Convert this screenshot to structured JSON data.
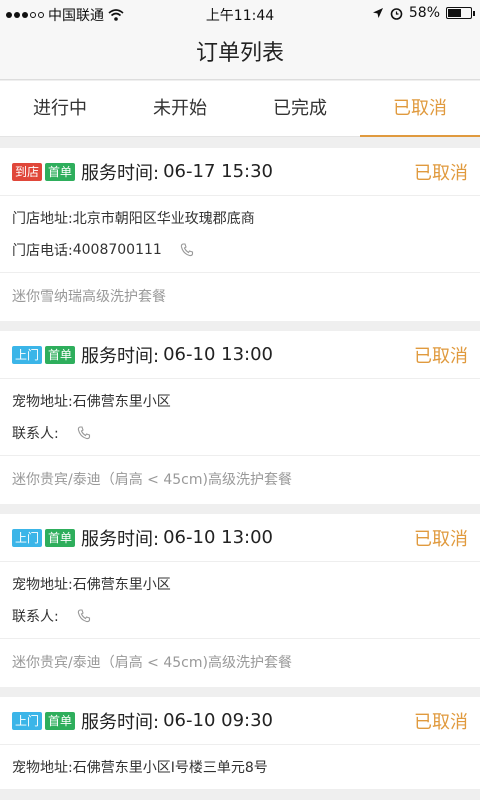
{
  "status_bar": {
    "carrier": "中国联通",
    "time": "上午11:44",
    "battery": "58%",
    "battery_level": 0.58
  },
  "nav": {
    "title": "订单列表"
  },
  "tabs": [
    {
      "label": "进行中",
      "active": false
    },
    {
      "label": "未开始",
      "active": false
    },
    {
      "label": "已完成",
      "active": false
    },
    {
      "label": "已取消",
      "active": true
    }
  ],
  "colors": {
    "accent": "#e09a3e",
    "badge_store": "#e0473a",
    "badge_home": "#3bb5e8",
    "badge_first": "#2eae5c"
  },
  "orders": [
    {
      "badges": [
        {
          "text": "到店",
          "kind": "store"
        },
        {
          "text": "首单",
          "kind": "first"
        }
      ],
      "time_label": "服务时间:",
      "time_value": "06-17 15:30",
      "status": "已取消",
      "rows": [
        {
          "label": "门店地址:",
          "value": "北京市朝阳区华业玫瑰郡底商",
          "phone": false
        },
        {
          "label": "门店电话:",
          "value": "4008700111",
          "phone": true
        }
      ],
      "service": "迷你雪纳瑞高级洗护套餐"
    },
    {
      "badges": [
        {
          "text": "上门",
          "kind": "home"
        },
        {
          "text": "首单",
          "kind": "first"
        }
      ],
      "time_label": "服务时间:",
      "time_value": "06-10 13:00",
      "status": "已取消",
      "rows": [
        {
          "label": "宠物地址:",
          "value": "石佛营东里小区",
          "phone": false
        },
        {
          "label": "联系人:",
          "value": "",
          "phone": true
        }
      ],
      "service": "迷你贵宾/泰迪（肩高 < 45cm)高级洗护套餐"
    },
    {
      "badges": [
        {
          "text": "上门",
          "kind": "home"
        },
        {
          "text": "首单",
          "kind": "first"
        }
      ],
      "time_label": "服务时间:",
      "time_value": "06-10 13:00",
      "status": "已取消",
      "rows": [
        {
          "label": "宠物地址:",
          "value": "石佛营东里小区",
          "phone": false
        },
        {
          "label": "联系人:",
          "value": "",
          "phone": true
        }
      ],
      "service": "迷你贵宾/泰迪（肩高 < 45cm)高级洗护套餐"
    },
    {
      "badges": [
        {
          "text": "上门",
          "kind": "home"
        },
        {
          "text": "首单",
          "kind": "first"
        }
      ],
      "time_label": "服务时间:",
      "time_value": "06-10 09:30",
      "status": "已取消",
      "rows": [
        {
          "label": "宠物地址:",
          "value": "石佛营东里小区I号楼三单元8号",
          "phone": false
        }
      ],
      "service": ""
    }
  ]
}
